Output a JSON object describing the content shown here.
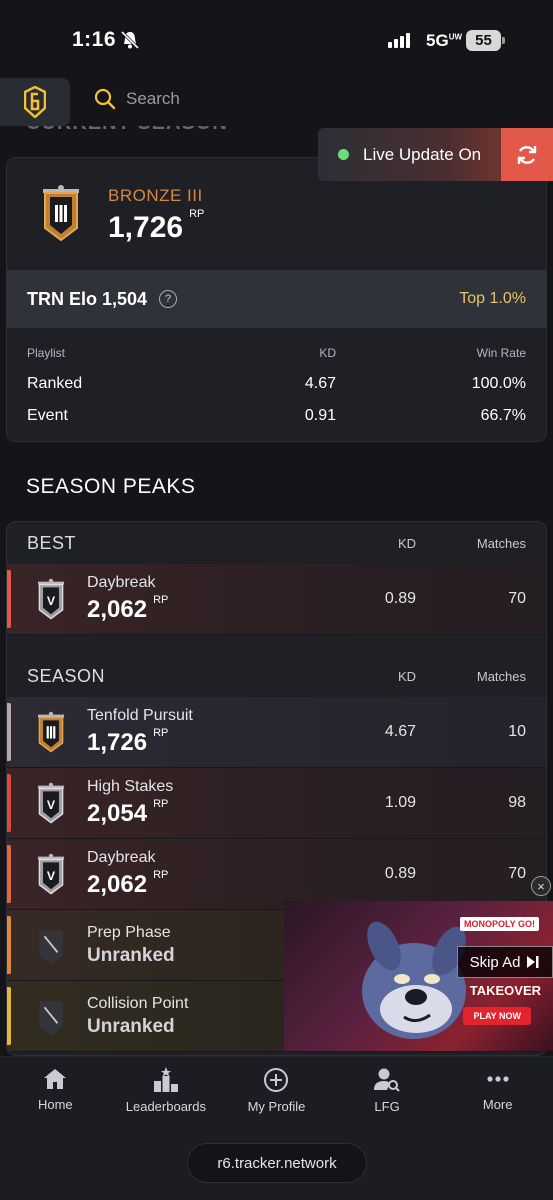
{
  "status_bar": {
    "time": "1:16",
    "network": "5G",
    "network_sup": "UW",
    "battery": "55"
  },
  "header": {
    "search_placeholder": "Search"
  },
  "faded_section_title": "CURRENT SEASON",
  "live_update": {
    "label": "Live Update On"
  },
  "current_season": {
    "rank_name": "BRONZE III",
    "rp": "1,726",
    "rp_unit": "RP",
    "elo_label": "TRN Elo 1,504",
    "help": "?",
    "top_percent": "Top 1.0%",
    "columns": [
      "Playlist",
      "KD",
      "Win Rate"
    ],
    "rows": [
      {
        "playlist": "Ranked",
        "kd": "4.67",
        "win_rate": "100.0%"
      },
      {
        "playlist": "Event",
        "kd": "0.91",
        "win_rate": "66.7%"
      }
    ]
  },
  "season_peaks": {
    "title": "SEASON PEAKS",
    "best": {
      "label": "BEST",
      "kd_header": "KD",
      "matches_header": "Matches",
      "row": {
        "name": "Daybreak",
        "rp": "2,062",
        "rp_unit": "RP",
        "kd": "0.89",
        "matches": "70"
      }
    },
    "season": {
      "label": "SEASON",
      "kd_header": "KD",
      "matches_header": "Matches",
      "rows": [
        {
          "name": "Tenfold Pursuit",
          "rp": "1,726",
          "rp_unit": "RP",
          "kd": "4.67",
          "matches": "10"
        },
        {
          "name": "High Stakes",
          "rp": "2,054",
          "rp_unit": "RP",
          "kd": "1.09",
          "matches": "98"
        },
        {
          "name": "Daybreak",
          "rp": "2,062",
          "rp_unit": "RP",
          "kd": "0.89",
          "matches": "70"
        },
        {
          "name": "Prep Phase",
          "status": "Unranked"
        },
        {
          "name": "Collision Point",
          "status": "Unranked"
        }
      ]
    }
  },
  "ad": {
    "skip_label": "Skip Ad",
    "close": "×",
    "brand": "MONOPOLY GO!",
    "headline": "TAKEOVER",
    "cta": "PLAY NOW"
  },
  "bottom_nav": {
    "items": [
      {
        "label": "Home",
        "icon": "home-icon"
      },
      {
        "label": "Leaderboards",
        "icon": "leaderboards-icon"
      },
      {
        "label": "My Profile",
        "icon": "plus-circle-icon"
      },
      {
        "label": "LFG",
        "icon": "user-search-icon"
      },
      {
        "label": "More",
        "icon": "more-icon"
      }
    ],
    "url": "r6.tracker.network"
  },
  "colors": {
    "accent_orange": "#e2594a",
    "bronze": "#d6883f",
    "gold": "#e6c46a",
    "live_dot": "#6ddb7a"
  }
}
